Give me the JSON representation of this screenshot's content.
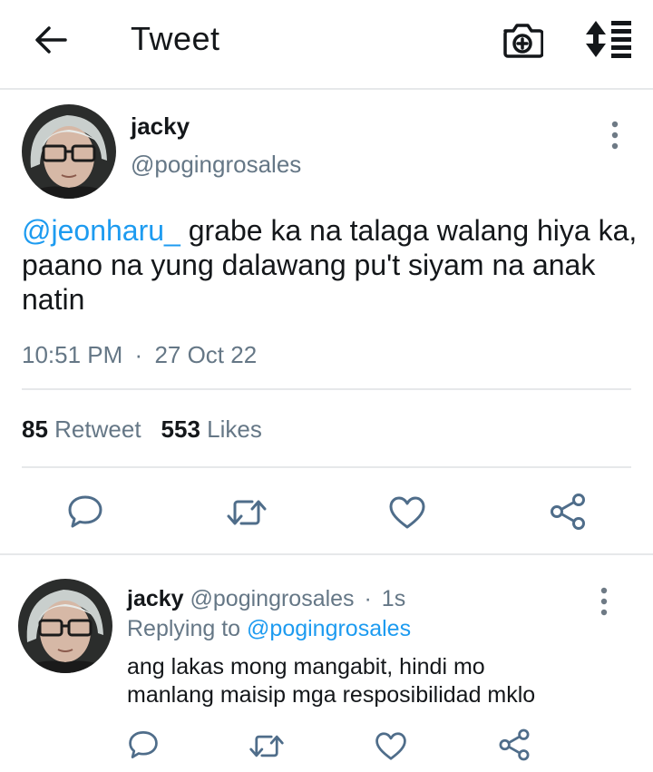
{
  "header": {
    "title": "Tweet",
    "back_icon": "arrow-left-icon",
    "camera_icon": "camera-add-icon",
    "sort_icon": "sort-list-icon"
  },
  "tweet": {
    "name": "jacky",
    "handle": "@pogingrosales",
    "mention": "@jeonharu_",
    "text": " grabe ka na talaga walang hiya ka, paano na yung dalawang pu't siyam na anak natin",
    "time": "10:51 PM",
    "separator": "·",
    "date": "27 Oct 22",
    "retweet_count": "85",
    "retweet_label": "Retweet",
    "like_count": "553",
    "like_label": "Likes"
  },
  "reply": {
    "name": "jacky",
    "handle": "@pogingrosales",
    "separator": "·",
    "time": "1s",
    "replying_prefix": "Replying to",
    "replying_handle": "@pogingrosales",
    "text_line1": "ang lakas mong mangabit, hindi mo",
    "text_line2": "manlang maisip mga resposibilidad mklo"
  },
  "colors": {
    "accent": "#1d9bf0",
    "text_primary": "#14171a",
    "text_secondary": "#657786",
    "icon": "#4f6d8a",
    "divider": "#e6e8ea"
  }
}
